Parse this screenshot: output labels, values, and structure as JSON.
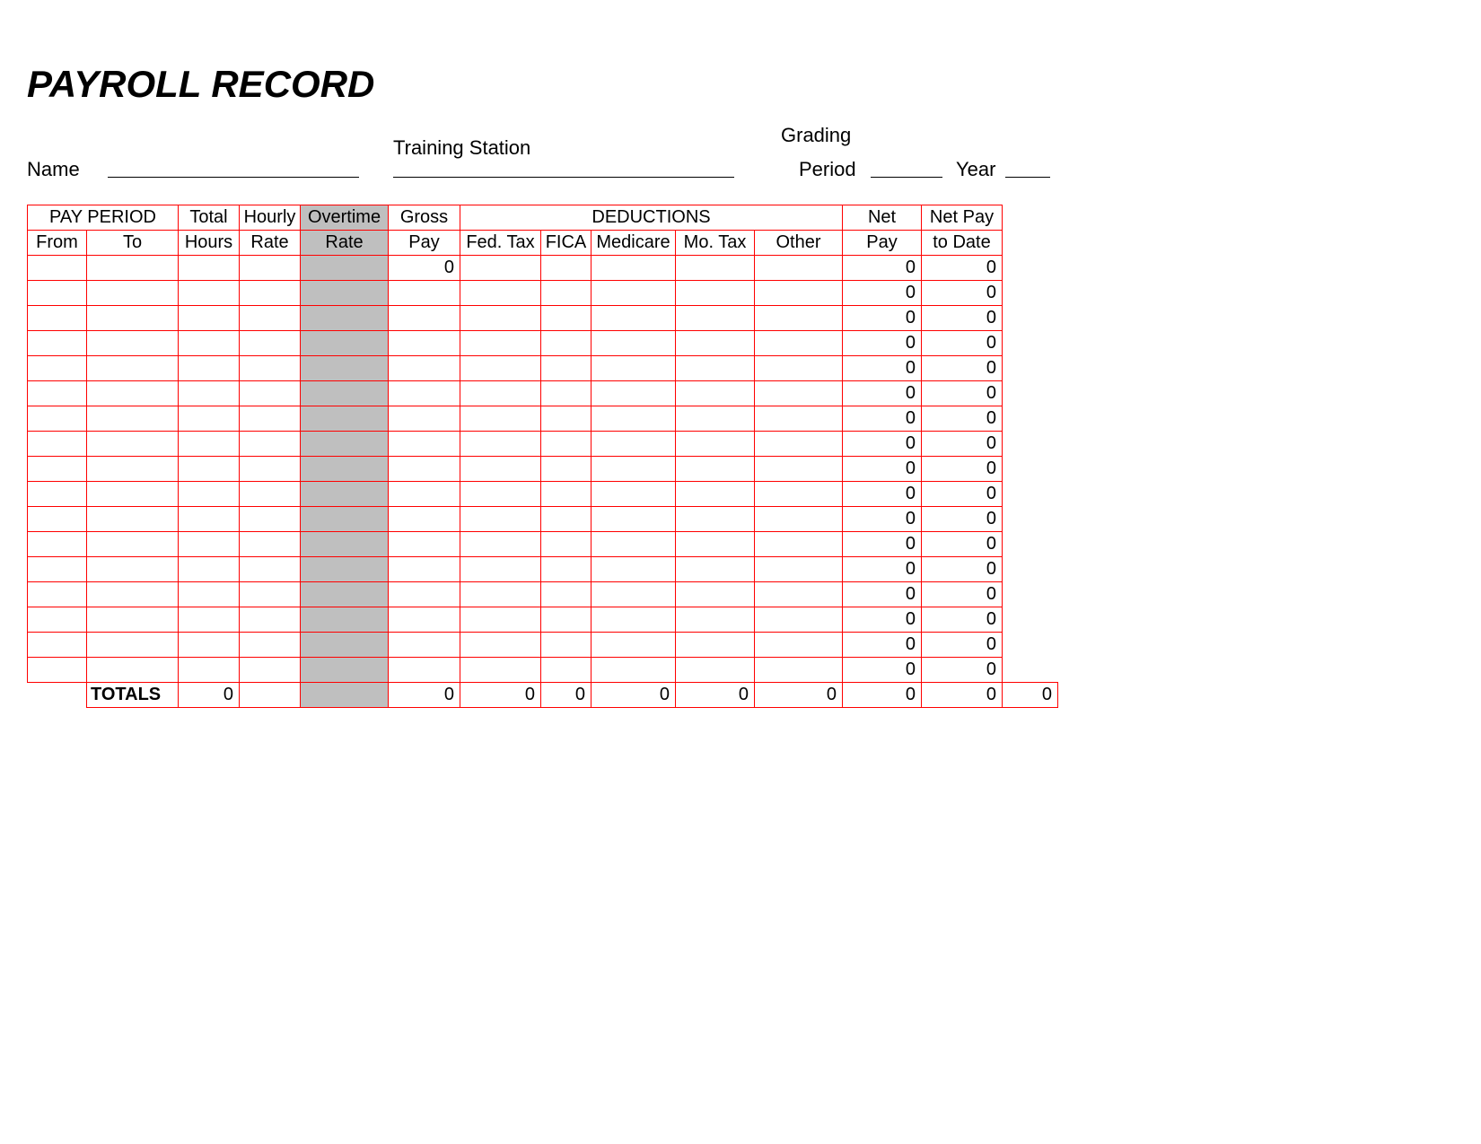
{
  "title": "PAYROLL RECORD",
  "labels": {
    "grading": "Grading",
    "name": "Name",
    "station": "Training Station",
    "period": "Period",
    "year": "Year"
  },
  "headers": {
    "payPeriod": "PAY PERIOD",
    "from": "From",
    "to": "To",
    "totalHours1": "Total",
    "totalHours2": "Hours",
    "hourlyRate1": "Hourly",
    "hourlyRate2": "Rate",
    "overtimeRate1": "Overtime",
    "overtimeRate2": "Rate",
    "grossPay1": "Gross",
    "grossPay2": "Pay",
    "deductions": "DEDUCTIONS",
    "fedTax": "Fed. Tax",
    "fica": "FICA",
    "medicare": "Medicare",
    "moTax": "Mo. Tax",
    "other": "Other",
    "netPay1": "Net",
    "netPay2": "Pay",
    "netToDate1": "Net Pay",
    "netToDate2": "to Date"
  },
  "rows": [
    {
      "from": "",
      "to": "",
      "th": "",
      "hr": "",
      "ot": "",
      "gp": "0",
      "fed": "",
      "fica": "",
      "med": "",
      "mo": "",
      "oth": "",
      "net": "0",
      "ntd": "0"
    },
    {
      "from": "",
      "to": "",
      "th": "",
      "hr": "",
      "ot": "",
      "gp": "",
      "fed": "",
      "fica": "",
      "med": "",
      "mo": "",
      "oth": "",
      "net": "0",
      "ntd": "0"
    },
    {
      "from": "",
      "to": "",
      "th": "",
      "hr": "",
      "ot": "",
      "gp": "",
      "fed": "",
      "fica": "",
      "med": "",
      "mo": "",
      "oth": "",
      "net": "0",
      "ntd": "0"
    },
    {
      "from": "",
      "to": "",
      "th": "",
      "hr": "",
      "ot": "",
      "gp": "",
      "fed": "",
      "fica": "",
      "med": "",
      "mo": "",
      "oth": "",
      "net": "0",
      "ntd": "0"
    },
    {
      "from": "",
      "to": "",
      "th": "",
      "hr": "",
      "ot": "",
      "gp": "",
      "fed": "",
      "fica": "",
      "med": "",
      "mo": "",
      "oth": "",
      "net": "0",
      "ntd": "0"
    },
    {
      "from": "",
      "to": "",
      "th": "",
      "hr": "",
      "ot": "",
      "gp": "",
      "fed": "",
      "fica": "",
      "med": "",
      "mo": "",
      "oth": "",
      "net": "0",
      "ntd": "0"
    },
    {
      "from": "",
      "to": "",
      "th": "",
      "hr": "",
      "ot": "",
      "gp": "",
      "fed": "",
      "fica": "",
      "med": "",
      "mo": "",
      "oth": "",
      "net": "0",
      "ntd": "0"
    },
    {
      "from": "",
      "to": "",
      "th": "",
      "hr": "",
      "ot": "",
      "gp": "",
      "fed": "",
      "fica": "",
      "med": "",
      "mo": "",
      "oth": "",
      "net": "0",
      "ntd": "0"
    },
    {
      "from": "",
      "to": "",
      "th": "",
      "hr": "",
      "ot": "",
      "gp": "",
      "fed": "",
      "fica": "",
      "med": "",
      "mo": "",
      "oth": "",
      "net": "0",
      "ntd": "0"
    },
    {
      "from": "",
      "to": "",
      "th": "",
      "hr": "",
      "ot": "",
      "gp": "",
      "fed": "",
      "fica": "",
      "med": "",
      "mo": "",
      "oth": "",
      "net": "0",
      "ntd": "0"
    },
    {
      "from": "",
      "to": "",
      "th": "",
      "hr": "",
      "ot": "",
      "gp": "",
      "fed": "",
      "fica": "",
      "med": "",
      "mo": "",
      "oth": "",
      "net": "0",
      "ntd": "0"
    },
    {
      "from": "",
      "to": "",
      "th": "",
      "hr": "",
      "ot": "",
      "gp": "",
      "fed": "",
      "fica": "",
      "med": "",
      "mo": "",
      "oth": "",
      "net": "0",
      "ntd": "0"
    },
    {
      "from": "",
      "to": "",
      "th": "",
      "hr": "",
      "ot": "",
      "gp": "",
      "fed": "",
      "fica": "",
      "med": "",
      "mo": "",
      "oth": "",
      "net": "0",
      "ntd": "0"
    },
    {
      "from": "",
      "to": "",
      "th": "",
      "hr": "",
      "ot": "",
      "gp": "",
      "fed": "",
      "fica": "",
      "med": "",
      "mo": "",
      "oth": "",
      "net": "0",
      "ntd": "0"
    },
    {
      "from": "",
      "to": "",
      "th": "",
      "hr": "",
      "ot": "",
      "gp": "",
      "fed": "",
      "fica": "",
      "med": "",
      "mo": "",
      "oth": "",
      "net": "0",
      "ntd": "0"
    },
    {
      "from": "",
      "to": "",
      "th": "",
      "hr": "",
      "ot": "",
      "gp": "",
      "fed": "",
      "fica": "",
      "med": "",
      "mo": "",
      "oth": "",
      "net": "0",
      "ntd": "0"
    },
    {
      "from": "",
      "to": "",
      "th": "",
      "hr": "",
      "ot": "",
      "gp": "",
      "fed": "",
      "fica": "",
      "med": "",
      "mo": "",
      "oth": "",
      "net": "0",
      "ntd": "0"
    }
  ],
  "totals": {
    "label": "TOTALS",
    "th": "0",
    "hr": "",
    "ot": "",
    "gp": "0",
    "fed": "0",
    "fica": "0",
    "med": "0",
    "mo": "0",
    "oth": "0",
    "net": "0",
    "ntd": "0",
    "ext": "0"
  }
}
